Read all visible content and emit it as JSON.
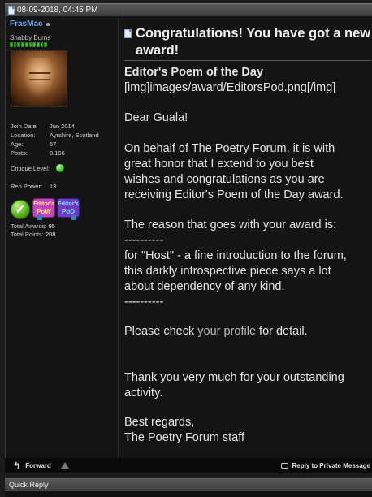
{
  "post": {
    "datetime": "08-09-2018, 04:45 PM",
    "title": "Congratulations! You have got a new award!",
    "heading_bold": "Editor's Poem of the Day",
    "img_tag": "[img]images/award/EditorsPod.png[/img]",
    "greeting": "Dear Guala!",
    "para1": [
      "On behalf of The Poetry Forum, it is with",
      "great honor that I extend to you best",
      "wishes and congratulations as you are",
      "receiving Editor's Poem of the Day award."
    ],
    "reason_intro": "The reason that goes with your award is:",
    "dashes": "----------",
    "reason_lines": [
      "for \"Host\" - a fine introduction to the forum,",
      "this darkly introspective piece says a lot",
      "about dependency of any kind."
    ],
    "check_prefix": "Please check ",
    "check_link": "your profile",
    "check_suffix": " for detail.",
    "thanks": [
      "Thank you very much for your outstanding",
      "activity."
    ],
    "signoff": [
      "Best regards,",
      "The Poetry Forum staff"
    ]
  },
  "user": {
    "name": "FrasMac",
    "title": "Shabby Burns",
    "rep_segments": 10,
    "join_date_label": "Join Date:",
    "join_date": "Jun 2014",
    "location_label": "Location:",
    "location": "Ayrshire, Scotland",
    "age_label": "Age:",
    "age": "57",
    "posts_label": "Posts:",
    "posts": "8,106",
    "critique_label": "Critique Level:",
    "rep_power_label": "Rep Power:",
    "rep_power": "13",
    "badges": {
      "pow_l1": "Editor's",
      "pow_l2": "PoW",
      "pod_l1": "Editor's",
      "pod_l2": "PoD"
    },
    "total_awards_label": "Total Awards:",
    "total_awards": "95",
    "total_points_label": "Total Points:",
    "total_points": "208"
  },
  "footer": {
    "forward": "Forward",
    "reply_pm": "Reply to Private Message"
  },
  "quick_reply": "Quick Reply",
  "colors": {
    "username": "#6fa3e6",
    "rep_green": "#45c12f",
    "bg": "#141414"
  },
  "icons": {
    "header": "document-icon",
    "forward": "forward-arrow-icon",
    "warning": "warning-triangle-icon",
    "reply": "speech-bubble-icon"
  }
}
